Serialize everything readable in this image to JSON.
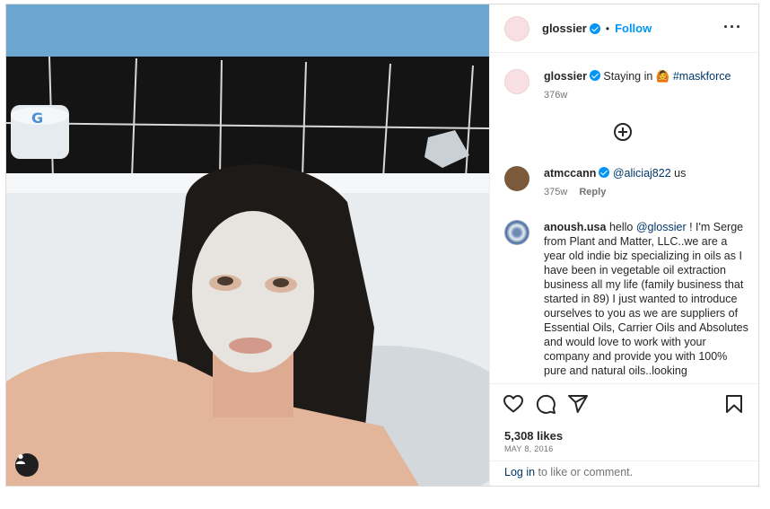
{
  "header": {
    "username": "glossier",
    "separator": "•",
    "follow_label": "Follow",
    "more_icon": "more-dots-icon"
  },
  "caption": {
    "username": "glossier",
    "text": "Staying in 🙆 ",
    "hashtag": "#maskforce",
    "time": "376w"
  },
  "comments": [
    {
      "username": "atmccann",
      "mention": "@aliciaj822",
      "text": " us",
      "time": "375w",
      "reply_label": "Reply"
    },
    {
      "username": "anoush.usa",
      "prefix": "hello ",
      "mention": "@glossier",
      "text": " ! I'm Serge from Plant and Matter, LLC..we are a year old indie biz specializing in oils as I have been in vegetable oil extraction business all my life (family business that started in 89) I just wanted to introduce ourselves to you as we are suppliers of Essential Oils, Carrier Oils and Absolutes and would love to work with your company and provide you with 100% pure and natural oils..looking"
    }
  ],
  "actions": {
    "likes": "5,308 likes",
    "date": "MAY 8, 2016",
    "icons": [
      "heart-icon",
      "comment-icon",
      "share-icon",
      "bookmark-icon"
    ]
  },
  "login": {
    "link_label": "Log in",
    "suffix": " to like or comment."
  },
  "colors": {
    "accent": "#0095f6",
    "link": "#00376b",
    "muted": "#737373"
  }
}
